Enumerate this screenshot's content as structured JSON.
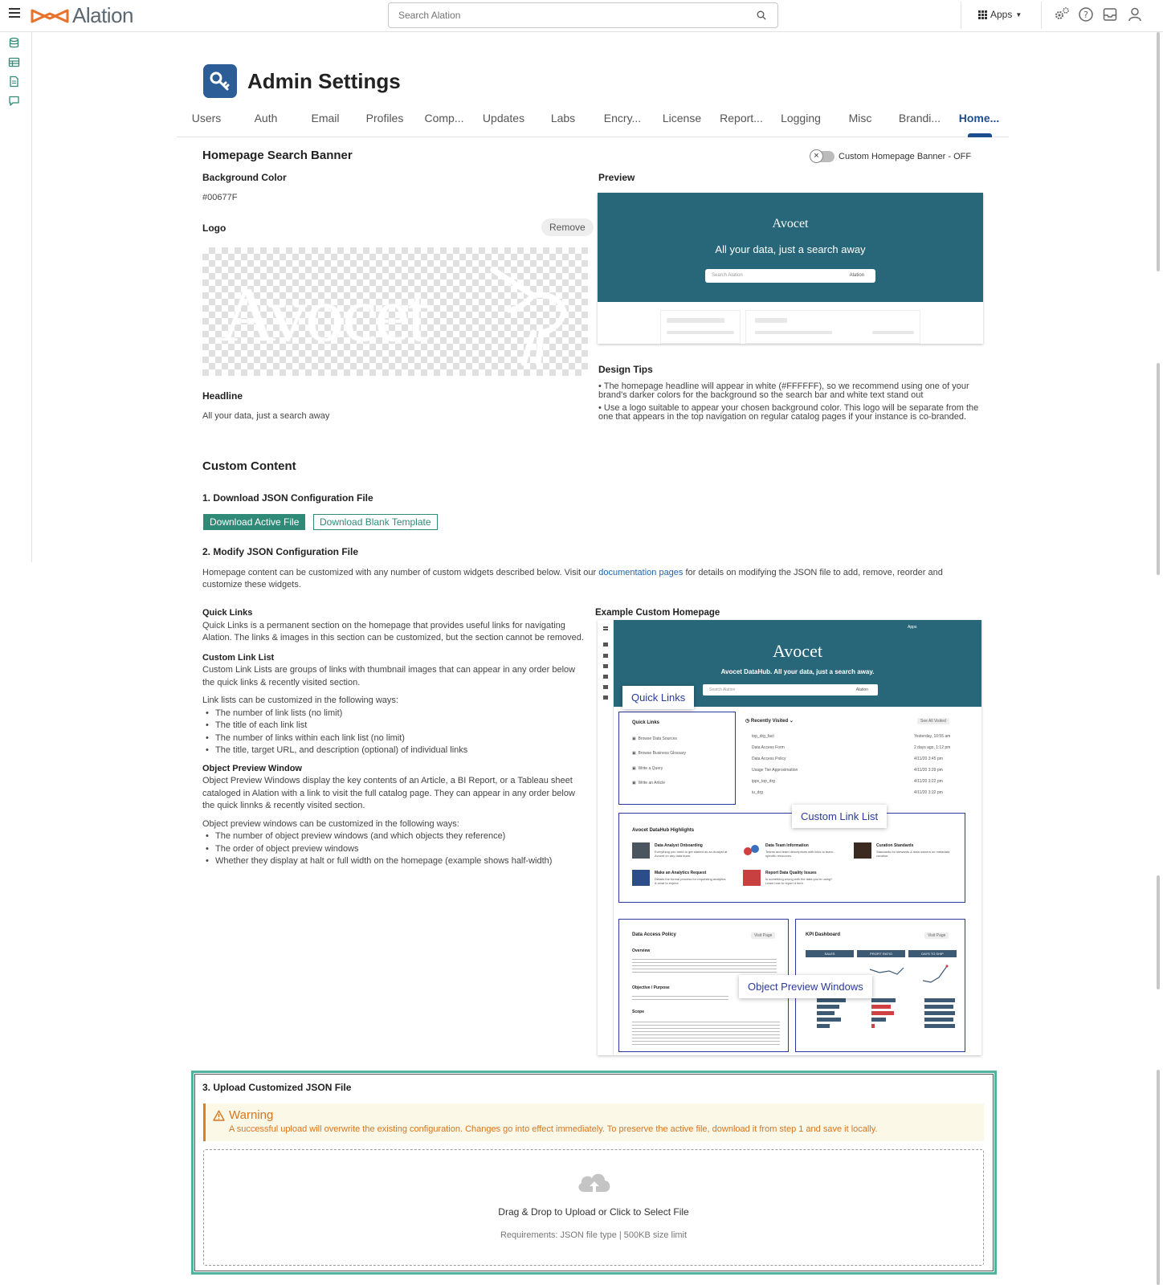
{
  "topnav": {
    "brand": "Alation",
    "search_placeholder": "Search Alation",
    "apps_label": "Apps"
  },
  "page": {
    "title": "Admin Settings",
    "tabs": [
      "Users",
      "Auth",
      "Email",
      "Profiles",
      "Comp...",
      "Updates",
      "Labs",
      "Encry...",
      "License",
      "Report...",
      "Logging",
      "Misc",
      "Brandi...",
      "Home..."
    ],
    "active_tab": "Home..."
  },
  "banner_section": {
    "title": "Homepage Search Banner",
    "toggle_label": "Custom Homepage Banner - OFF",
    "toggle_on": false,
    "background_color_label": "Background Color",
    "background_color_value": "#00677F",
    "logo_label": "Logo",
    "remove_label": "Remove",
    "logo_ghost_text": "Avocet",
    "headline_label": "Headline",
    "headline_value": "All your data, just a search away",
    "preview_label": "Preview",
    "preview_brand": "Avocet",
    "preview_headline": "All your data, just a search away",
    "preview_search_placeholder": "Search Alation",
    "preview_search_brand": "Alation",
    "design_tips_label": "Design Tips",
    "design_tips": [
      "The homepage headline will appear in white (#FFFFFF), so we recommend using one of your brand's darker colors for the background so the search bar and white text stand out",
      "Use a logo suitable to appear your chosen background color. This logo will be separate from the one that appears in the top navigation on regular catalog pages if your instance is co-branded."
    ]
  },
  "custom_content": {
    "title": "Custom Content",
    "step1_label": "1. Download JSON Configuration File",
    "download_active_label": "Download Active File",
    "download_blank_label": "Download Blank Template",
    "step2_label": "2. Modify JSON Configuration File",
    "step2_text_before": "Homepage content can be customized with any number of custom widgets described below. Visit our ",
    "step2_link": "documentation pages",
    "step2_text_after": " for details on modifying the JSON file to add, remove, reorder and customize these widgets.",
    "quick_links_title": "Quick Links",
    "quick_links_text": "Quick Links is a permanent section on the homepage that provides useful links for navigating Alation. The links & images in this section can be customized, but the section cannot be removed.",
    "custom_link_list_title": "Custom Link List",
    "custom_link_list_text": "Custom Link Lists are groups of links with thumbnail images that can appear in any order below the quick links & recently visited section.",
    "link_list_intro": "Link lists can be customized in the following ways:",
    "link_list_items": [
      "The number of link lists (no limit)",
      "The title of each link list",
      "The number of links within each link list (no limit)",
      "The title, target URL, and description (optional) of individual links"
    ],
    "opw_title": "Object Preview Window",
    "opw_text": "Object Preview Windows display the key contents of an Article, a BI Report, or a Tableau sheet cataloged in Alation with a link to visit the full catalog page. They can appear in any order below the quick linnks & recently visited section.",
    "opw_intro": "Object preview windows can be customized in the following ways:",
    "opw_items": [
      "The number of object preview windows (and which objects they reference)",
      "The order of object preview windows",
      "Whether they display at halt or full width on the homepage (example shows half-width)"
    ],
    "example_label": "Example Custom Homepage"
  },
  "example_homepage": {
    "brand": "Avocet",
    "headline": "Avocet DataHub. All your data, just a search away.",
    "search_placeholder": "Search Alation",
    "search_brand": "Alation",
    "apps": "Apps",
    "quick_links_title": "Quick Links",
    "quick_links": [
      "Browse Data Sources",
      "Browse Business Glossary",
      "Write a Query",
      "Write an Article"
    ],
    "recently_visited_title": "Recently Visited",
    "see_all": "See All Visited",
    "recent_items": [
      {
        "name": "top_drg_fact",
        "time": "Yesterday, 10:55 am"
      },
      {
        "name": "Data Access Form",
        "time": "2 days ago, 1:12 pm"
      },
      {
        "name": "Data Access Policy",
        "time": "4/11/20 3:45 pm"
      },
      {
        "name": "Usage Tier Approximation",
        "time": "4/11/20 3:29 pm"
      },
      {
        "name": "ippx_top_drg",
        "time": "4/11/20 3:22 pm"
      },
      {
        "name": "iu_drg",
        "time": "4/11/20 3:22 pm"
      }
    ],
    "highlights_title": "Avocet DataHub Highlights",
    "highlights": [
      {
        "title": "Data Analyst Onboarding",
        "desc": "Everything you need to get started as an Analyst at Avocet on any data team."
      },
      {
        "title": "Data Team Information",
        "desc": "Teams and team descriptions with links to team-specific resources."
      },
      {
        "title": "Curation Standards",
        "desc": "Standards for stewards & data owners on metadata curation."
      },
      {
        "title": "Make an Analytics Request",
        "desc": "Details the formal process for requesting analytics & what to expect."
      },
      {
        "title": "Report Data Quality Issues",
        "desc": "Is something wrong with the data you're using? Learn how to report it here."
      }
    ],
    "policy_title": "Data Access Policy",
    "visit_page": "Visit Page",
    "policy_overview": "Overview",
    "policy_objective": "Objective / Purpose",
    "policy_scope": "Scope",
    "kpi_title": "KPI Dashboard",
    "kpi_headers": [
      "SALES",
      "PROFIT RATIO",
      "DAYS TO SHIP"
    ],
    "callout_quick_links": "Quick Links",
    "callout_custom_link_list": "Custom Link List",
    "callout_opw": "Object Preview Windows"
  },
  "upload": {
    "step3_label": "3. Upload Customized JSON File",
    "warning_title": "Warning",
    "warning_message": "A successful upload will overwrite the existing configuration. Changes go into effect immediately. To preserve the active file, download it from step 1 and save it locally.",
    "dropzone_label": "Drag & Drop to Upload or Click to Select File",
    "requirements": "Requirements: JSON file type | 500KB size limit"
  },
  "colors": {
    "accent": "#2f8a78",
    "brand_blue": "#1d4e8f",
    "banner_teal": "#28677a",
    "warning": "#d7751f",
    "upload_border": "#4fb3a0"
  }
}
